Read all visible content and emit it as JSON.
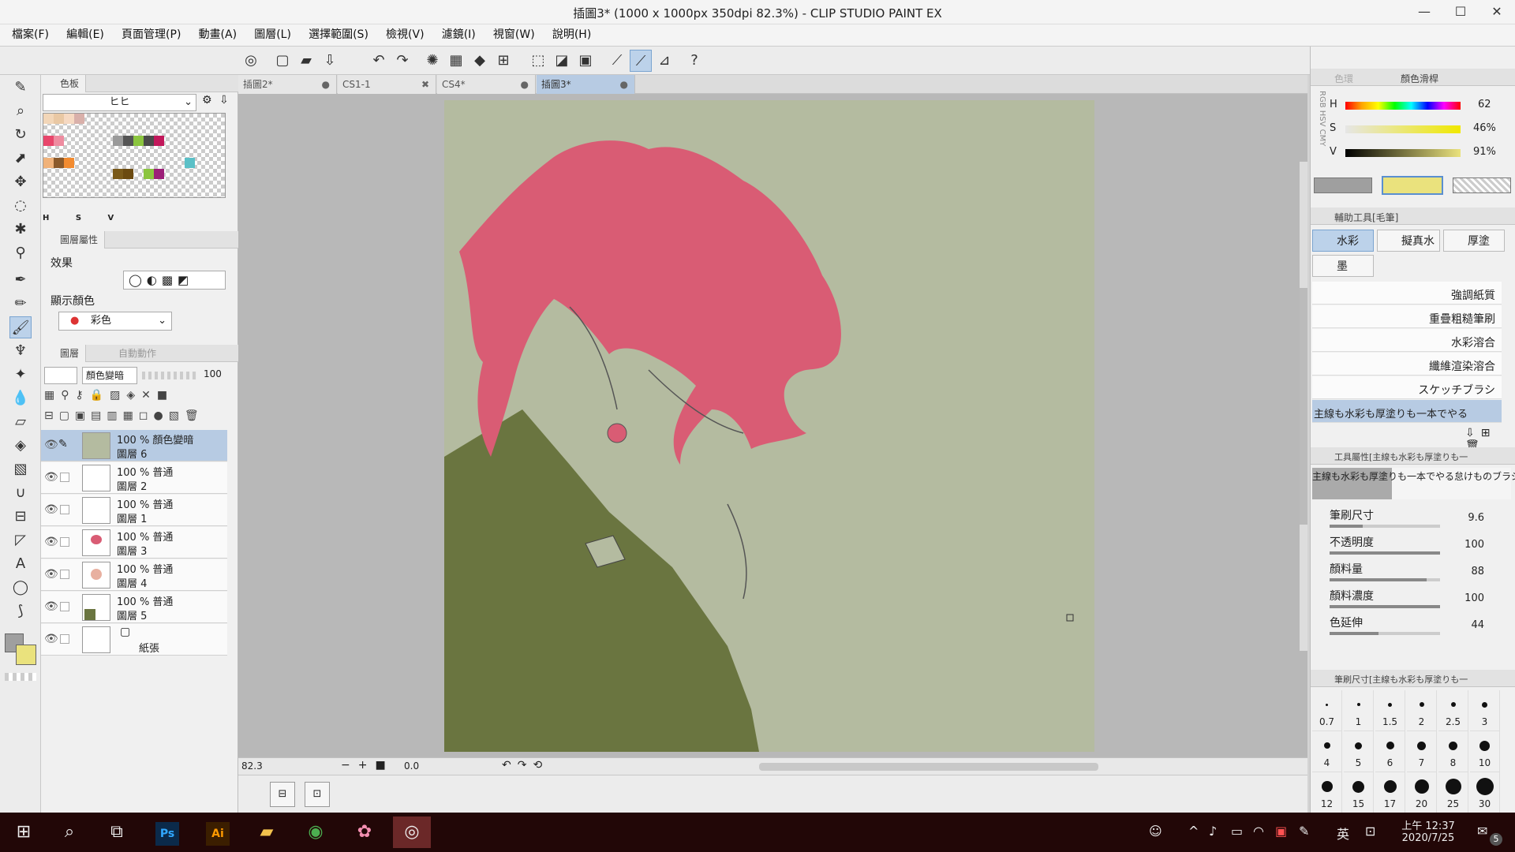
{
  "window": {
    "title": "插圖3* (1000 x 1000px 350dpi 82.3%)  - CLIP STUDIO PAINT EX",
    "minimize": "—",
    "maximize": "☐",
    "close": "✕"
  },
  "menu": [
    "檔案(F)",
    "編輯(E)",
    "頁面管理(P)",
    "動畫(A)",
    "圖層(L)",
    "選擇範圍(S)",
    "檢視(V)",
    "濾鏡(I)",
    "視窗(W)",
    "說明(H)"
  ],
  "left_panel": {
    "color_set": {
      "tab": "色板",
      "set_name": "ヒヒ",
      "hsv_labels": [
        "H",
        "S",
        "V"
      ]
    },
    "layer_props": {
      "tab": "圖層屬性",
      "effect_label": "效果",
      "display_color_label": "顯示顏色",
      "display_color_value": "彩色"
    },
    "layers_panel": {
      "tab_layer": "圖層",
      "tab_auto": "自動動作",
      "blend_mode": "顏色變暗",
      "opacity": "100",
      "layers": [
        {
          "line1": "100 % 顏色變暗",
          "line2": "圖層 6",
          "thumb": "#b4bba0"
        },
        {
          "line1": "100 % 普通",
          "line2": "圖層 2",
          "thumb": "#ffffff"
        },
        {
          "line1": "100 % 普通",
          "line2": "圖層 1",
          "thumb": "#ffffff"
        },
        {
          "line1": "100 % 普通",
          "line2": "圖層 3",
          "thumb": "#d95c74"
        },
        {
          "line1": "100 % 普通",
          "line2": "圖層 4",
          "thumb": "#e8b0a0"
        },
        {
          "line1": "100 % 普通",
          "line2": "圖層 5",
          "thumb": "#6a7540"
        },
        {
          "line1": "",
          "line2": "紙張",
          "thumb": "#ffffff"
        }
      ]
    }
  },
  "canvas": {
    "tabs": [
      {
        "label": "插圖2*",
        "close": "●"
      },
      {
        "label": "CS1-1",
        "close": "✖"
      },
      {
        "label": "CS4*",
        "close": "●"
      },
      {
        "label": "插圖3*",
        "close": "●"
      }
    ],
    "zoom": "82.3",
    "angle": "0.0",
    "bg": "#b4bba0",
    "hair": "#d95c74",
    "coat": "#6a7540"
  },
  "right_panel": {
    "color_tabs": [
      "色環",
      "顏色滑桿"
    ],
    "side_modes": [
      "RGB",
      "HSV",
      "CMY"
    ],
    "hsv": [
      {
        "label": "H",
        "value": "62"
      },
      {
        "label": "S",
        "value": "46%"
      },
      {
        "label": "V",
        "value": "91%"
      }
    ],
    "main_color": "#eae27d",
    "sub_color": "#9f9f9f",
    "subtool_header": "輔助工具[毛筆]",
    "subtools": [
      "水彩",
      "擬真水",
      "厚塗",
      "墨"
    ],
    "brushes": [
      "強調紙質",
      "重疊粗糙筆刷",
      "水彩溶合",
      "纖維渲染溶合",
      "スケッチブラシ",
      "主線も水彩も厚塗りも一本でやる"
    ],
    "tool_prop_header": "工具屬性[主線も水彩も厚塗りも一",
    "tool_prop_name": "主線も水彩も厚塗りも一本でやる怠けものブラシ",
    "props": [
      {
        "name": "筆刷尺寸",
        "value": "9.6",
        "fill": 0.3
      },
      {
        "name": "不透明度",
        "value": "100",
        "fill": 1.0
      },
      {
        "name": "顏料量",
        "value": "88",
        "fill": 0.88
      },
      {
        "name": "顏料濃度",
        "value": "100",
        "fill": 1.0
      },
      {
        "name": "色延伸",
        "value": "44",
        "fill": 0.44
      }
    ],
    "brush_size_header": "筆刷尺寸[主線も水彩も厚塗りも一",
    "sizes": [
      "0.7",
      "1",
      "1.5",
      "2",
      "2.5",
      "3",
      "4",
      "5",
      "6",
      "7",
      "8",
      "10",
      "12",
      "15",
      "17",
      "20",
      "25",
      "30"
    ]
  },
  "taskbar": {
    "time": "上午 12:37",
    "date": "2020/7/25",
    "ime": "英",
    "notif": "5"
  }
}
